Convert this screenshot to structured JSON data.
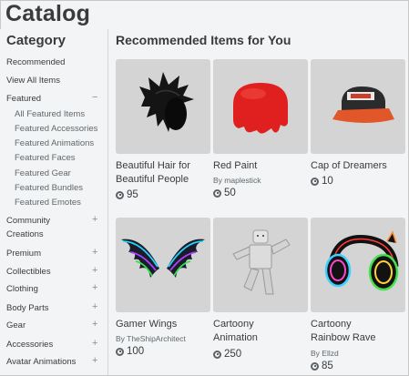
{
  "page": {
    "title": "Catalog"
  },
  "sidebar": {
    "heading": "Category",
    "items": [
      {
        "label": "Recommended",
        "toggle": ""
      },
      {
        "label": "View All Items",
        "toggle": ""
      },
      {
        "label": "Featured",
        "toggle": "−"
      }
    ],
    "featured_subitems": [
      "All Featured Items",
      "Featured Accessories",
      "Featured Animations",
      "Featured Faces",
      "Featured Gear",
      "Featured Bundles",
      "Featured Emotes"
    ],
    "categories": [
      {
        "label_line1": "Community",
        "label_line2": "Creations",
        "toggle": "+"
      },
      {
        "label_line1": "Premium",
        "toggle": "+"
      },
      {
        "label_line1": "Collectibles",
        "toggle": "+"
      },
      {
        "label_line1": "Clothing",
        "toggle": "+"
      },
      {
        "label_line1": "Body Parts",
        "toggle": "+"
      },
      {
        "label_line1": "Gear",
        "toggle": "+"
      },
      {
        "label_line1": "Accessories",
        "toggle": "+"
      },
      {
        "label_line1": "Avatar Animations",
        "toggle": "+"
      }
    ]
  },
  "main": {
    "heading": "Recommended Items for You",
    "items": [
      {
        "name_line1": "Beautiful Hair for",
        "name_line2": "Beautiful People",
        "by": "",
        "creator": "",
        "price": "95",
        "icon": "black-spiky-hair-icon"
      },
      {
        "name_line1": "Red Paint",
        "name_line2": "",
        "by": "By",
        "creator": "maplestick",
        "price": "50",
        "icon": "red-paint-hair-icon"
      },
      {
        "name_line1": "Cap of Dreamers",
        "name_line2": "",
        "by": "",
        "creator": "",
        "price": "10",
        "icon": "cap-icon"
      },
      {
        "name_line1": "Gamer Wings",
        "name_line2": "",
        "by": "By",
        "creator": "TheShipArchitect",
        "price": "100",
        "icon": "rainbow-wings-icon"
      },
      {
        "name_line1": "Cartoony",
        "name_line2": "Animation",
        "by": "",
        "creator": "",
        "price": "250",
        "icon": "cartoony-avatar-icon"
      },
      {
        "name_line1": "Cartoony",
        "name_line2": "Rainbow Rave",
        "by": "By",
        "creator": "Ellzd",
        "price": "85",
        "icon": "rainbow-headphones-icon"
      }
    ]
  },
  "colors": {
    "background": "#f2f4f5",
    "text": "#393b3d",
    "thumb_bg": "#d4d4d4",
    "paint_red": "#e0201f"
  }
}
